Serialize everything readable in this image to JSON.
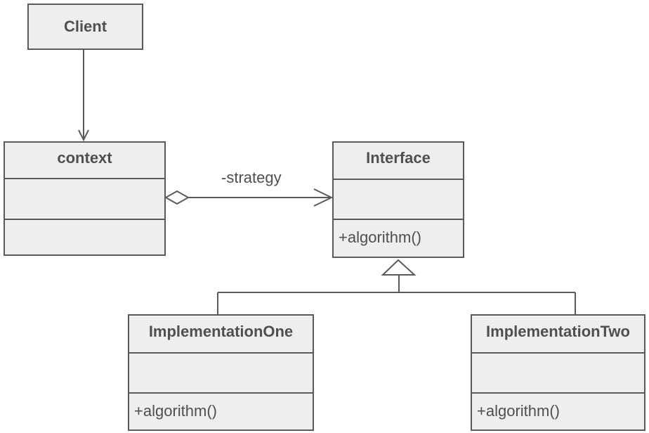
{
  "diagram": {
    "type": "UML class diagram (Strategy pattern)",
    "classes": {
      "client": {
        "name": "Client"
      },
      "context": {
        "name": "context",
        "attributes": "",
        "operations": ""
      },
      "interface": {
        "name": "Interface",
        "attributes": "",
        "operations": "+algorithm()"
      },
      "impl_one": {
        "name": "ImplementationOne",
        "attributes": "",
        "operations": "+algorithm()"
      },
      "impl_two": {
        "name": "ImplementationTwo",
        "attributes": "",
        "operations": "+algorithm()"
      }
    },
    "relations": [
      {
        "kind": "association",
        "from": "Client",
        "to": "context",
        "label": ""
      },
      {
        "kind": "aggregation",
        "from": "context",
        "to": "Interface",
        "label": "-strategy"
      },
      {
        "kind": "generalization",
        "from": "ImplementationOne",
        "to": "Interface",
        "label": ""
      },
      {
        "kind": "generalization",
        "from": "ImplementationTwo",
        "to": "Interface",
        "label": ""
      }
    ],
    "strategy_label": "-strategy"
  },
  "colors": {
    "line": "#5a5a5a",
    "box_fill": "#eeeeee",
    "text": "#4f4f4f"
  }
}
